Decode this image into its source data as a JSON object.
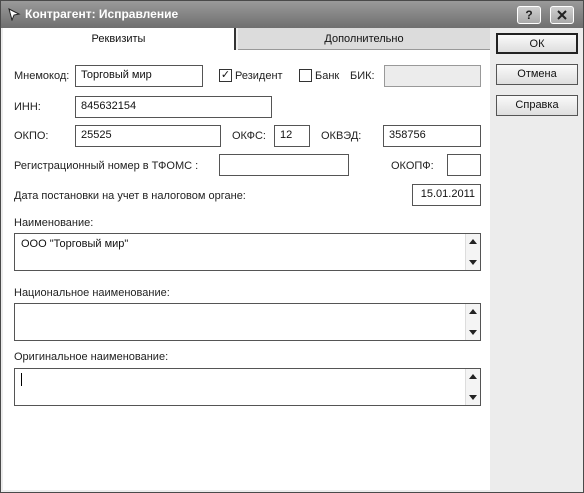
{
  "window": {
    "title": "Контрагент: Исправление",
    "help_btn": "?",
    "close_btn": "X"
  },
  "tabs": [
    {
      "label": "Реквизиты"
    },
    {
      "label": "Дополнительно"
    }
  ],
  "form": {
    "mnemocode_label": "Мнемокод:",
    "mnemocode_value": "Торговый мир",
    "resident_label": "Резидент",
    "resident_checked": "✓",
    "bank_label": "Банк",
    "bik_label": "БИК:",
    "bik_value": "",
    "inn_label": "ИНН:",
    "inn_value": "845632154",
    "okpo_label": "ОКПО:",
    "okpo_value": "25525",
    "okfs_label": "ОКФС:",
    "okfs_value": "12",
    "okved_label": "ОКВЭД:",
    "okved_value": "358756",
    "tfoms_label": "Регистрационный номер в ТФОМС :",
    "tfoms_value": "",
    "okopf_label": "ОКОПФ:",
    "okopf_value": "",
    "tax_date_label": "Дата постановки на учет в налоговом органе:",
    "tax_date_value": "15.01.2011",
    "name_label": "Наименование:",
    "name_value": "ООО \"Торговый мир\"",
    "national_name_label": "Национальное наименование:",
    "national_name_value": "",
    "original_name_label": "Оригинальное наименование:",
    "original_name_value": ""
  },
  "buttons": {
    "ok": "ОК",
    "cancel": "Отмена",
    "help": "Справка"
  }
}
